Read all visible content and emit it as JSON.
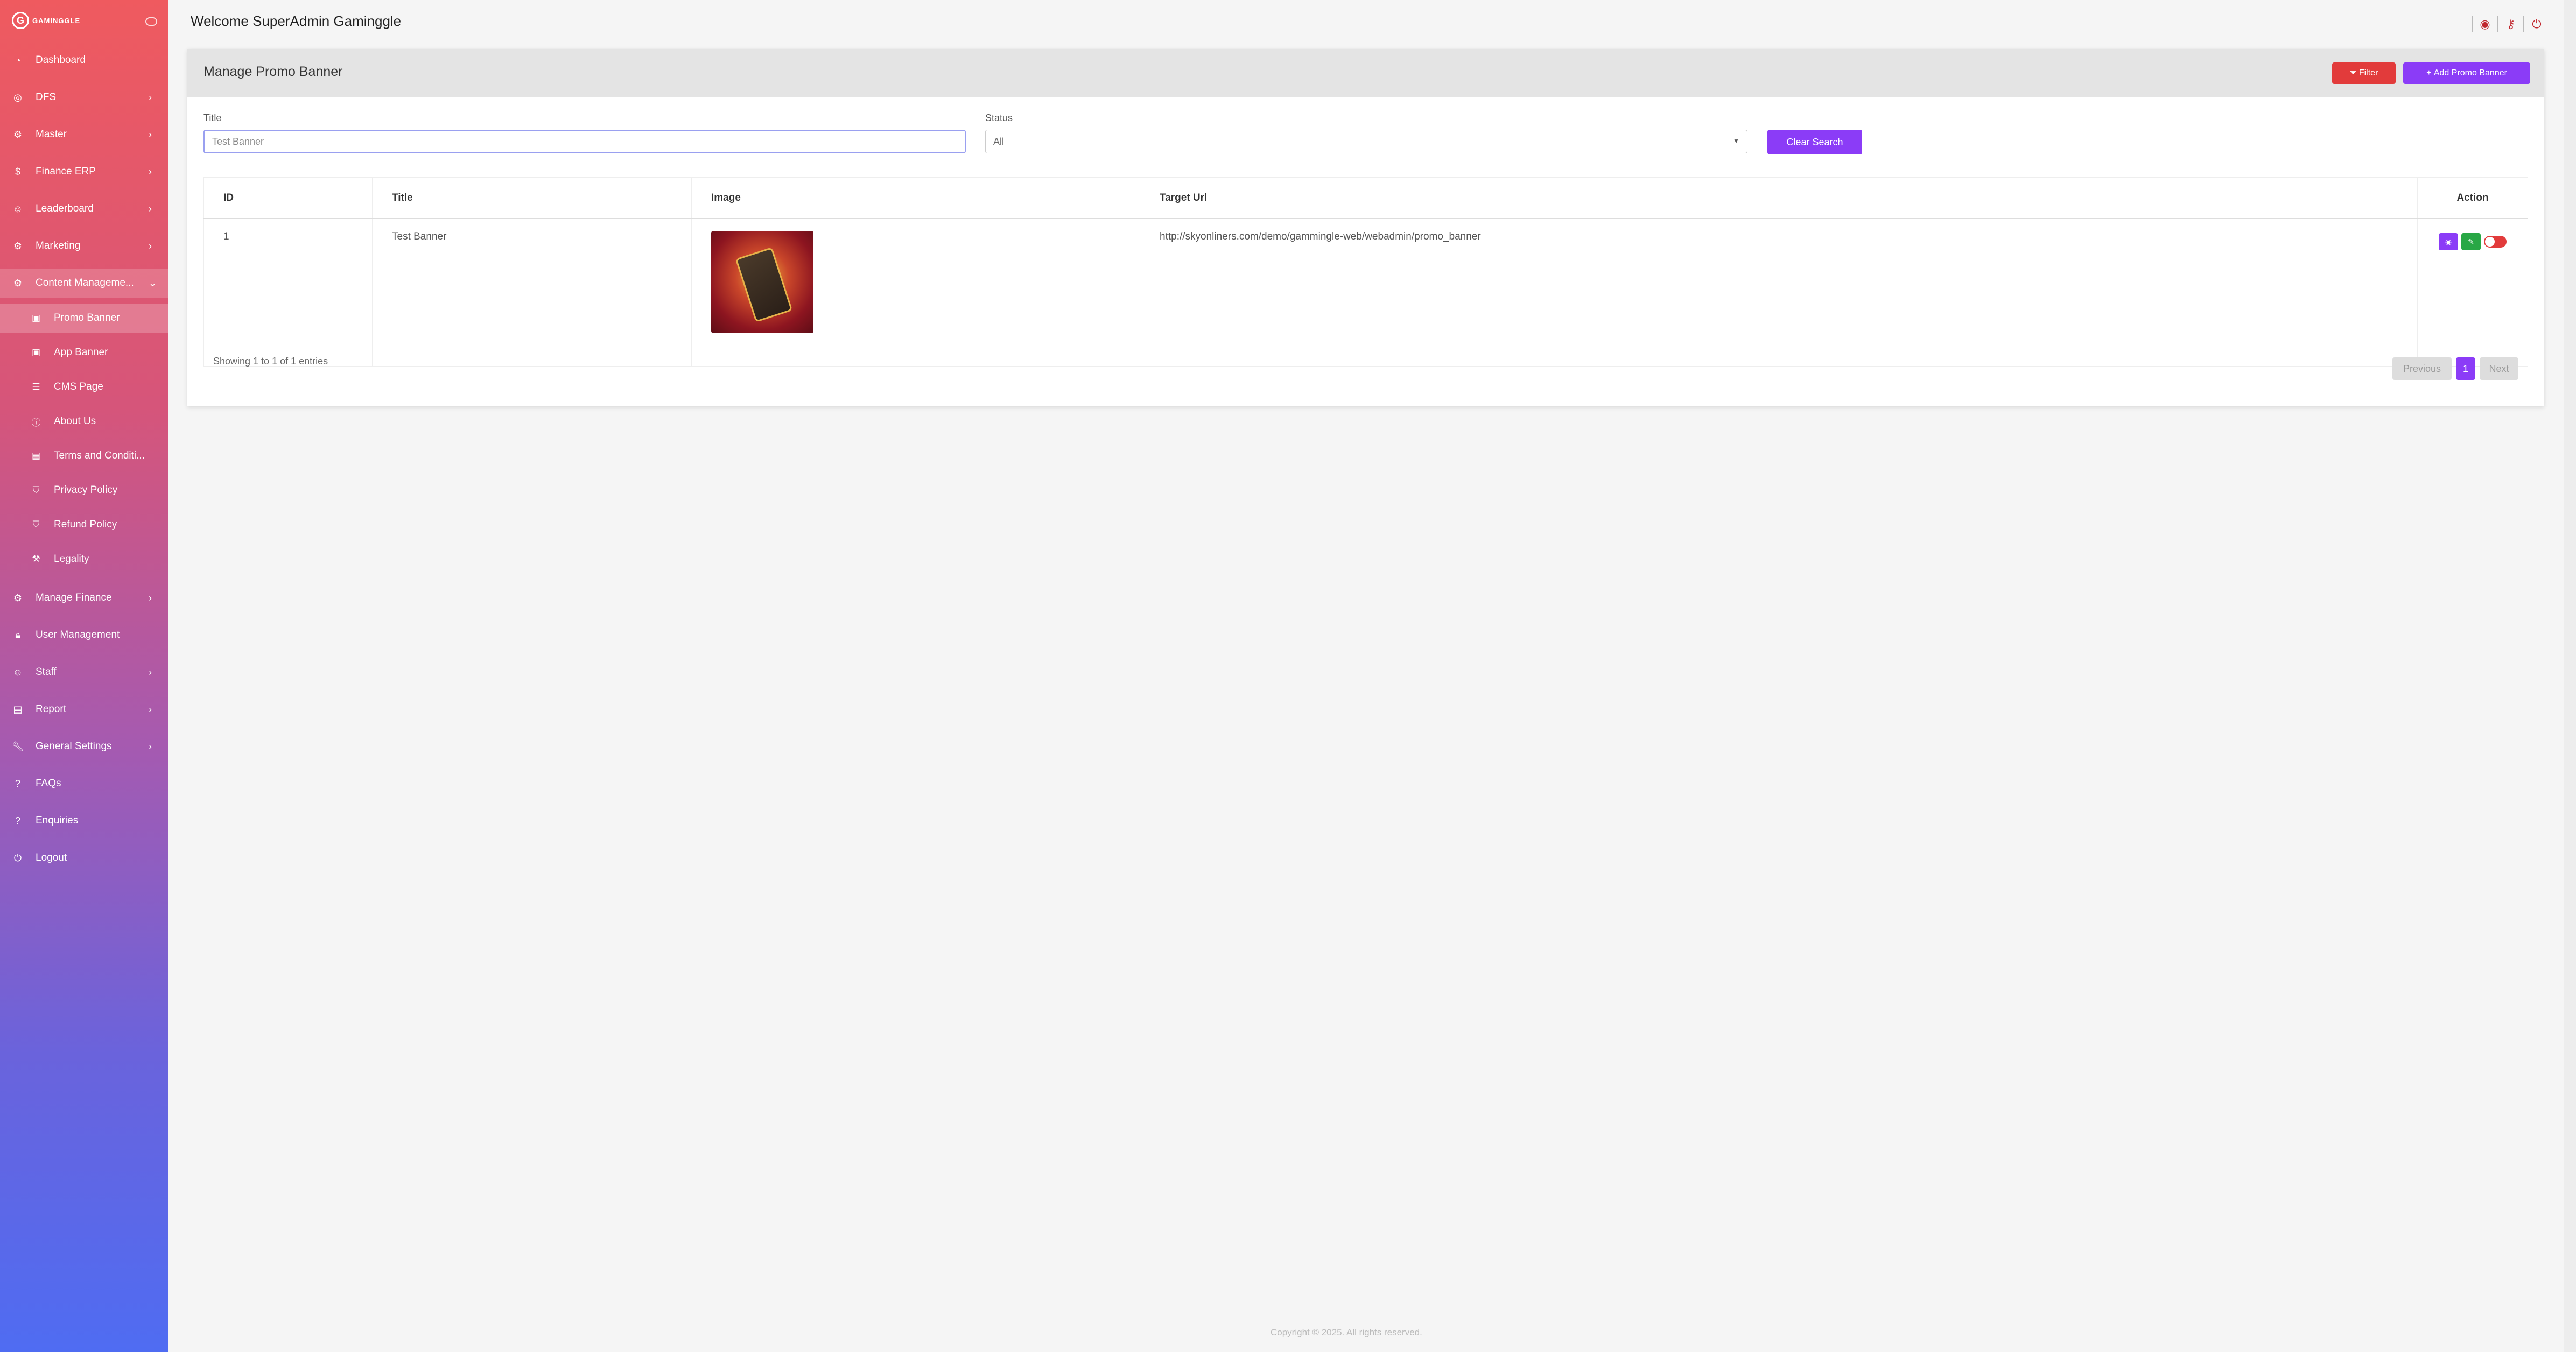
{
  "brand": {
    "logo_text": "GAMINGGLE"
  },
  "sidebar": {
    "items": [
      {
        "label": "Dashboard",
        "icon": "gauge-icon",
        "chevron": false
      },
      {
        "label": "DFS",
        "icon": "target-icon",
        "chevron": true
      },
      {
        "label": "Master",
        "icon": "cogs-icon",
        "chevron": true
      },
      {
        "label": "Finance ERP",
        "icon": "dollar-icon",
        "chevron": true
      },
      {
        "label": "Leaderboard",
        "icon": "user-icon",
        "chevron": true
      },
      {
        "label": "Marketing",
        "icon": "cogs-icon",
        "chevron": true
      },
      {
        "label": "Content Manageme...",
        "icon": "cogs-icon",
        "chevron": true,
        "expanded": true
      },
      {
        "label": "Manage Finance",
        "icon": "cogs-icon",
        "chevron": true
      },
      {
        "label": "User Management",
        "icon": "lock-icon",
        "chevron": false
      },
      {
        "label": "Staff",
        "icon": "user-icon",
        "chevron": true
      },
      {
        "label": "Report",
        "icon": "file-icon",
        "chevron": true
      },
      {
        "label": "General Settings",
        "icon": "wrench-icon",
        "chevron": true
      },
      {
        "label": "FAQs",
        "icon": "question-icon",
        "chevron": false
      },
      {
        "label": "Enquiries",
        "icon": "question-icon",
        "chevron": false
      },
      {
        "label": "Logout",
        "icon": "power-icon",
        "chevron": false
      }
    ],
    "sub_items": [
      {
        "label": "Promo Banner",
        "icon": "image-icon"
      },
      {
        "label": "App Banner",
        "icon": "image-icon"
      },
      {
        "label": "CMS Page",
        "icon": "list-icon"
      },
      {
        "label": "About Us",
        "icon": "info-icon"
      },
      {
        "label": "Terms and Conditi...",
        "icon": "file-icon"
      },
      {
        "label": "Privacy Policy",
        "icon": "shield-icon"
      },
      {
        "label": "Refund Policy",
        "icon": "shield-icon"
      },
      {
        "label": "Legality",
        "icon": "gavel-icon"
      }
    ]
  },
  "header": {
    "welcome": "Welcome SuperAdmin Gaminggle"
  },
  "card": {
    "title": "Manage Promo Banner",
    "filter_label": "Filter",
    "add_label": "Add Promo Banner"
  },
  "filters": {
    "title_label": "Title",
    "title_value": "Test Banner",
    "status_label": "Status",
    "status_value": "All",
    "clear_label": "Clear Search"
  },
  "table": {
    "headers": [
      "ID",
      "Title",
      "Image",
      "Target Url",
      "Action"
    ],
    "rows": [
      {
        "id": "1",
        "title": "Test Banner",
        "target_url": "http://skyonliners.com/demo/gammingle-web/webadmin/promo_banner"
      }
    ]
  },
  "pagination": {
    "info": "Showing 1 to 1 of 1 entries",
    "prev": "Previous",
    "page": "1",
    "next": "Next"
  },
  "footer": {
    "copyright": "Copyright © 2025. All rights reserved."
  },
  "colors": {
    "accent": "#8b3cf7",
    "danger": "#e23b3b",
    "success": "#28a745"
  }
}
